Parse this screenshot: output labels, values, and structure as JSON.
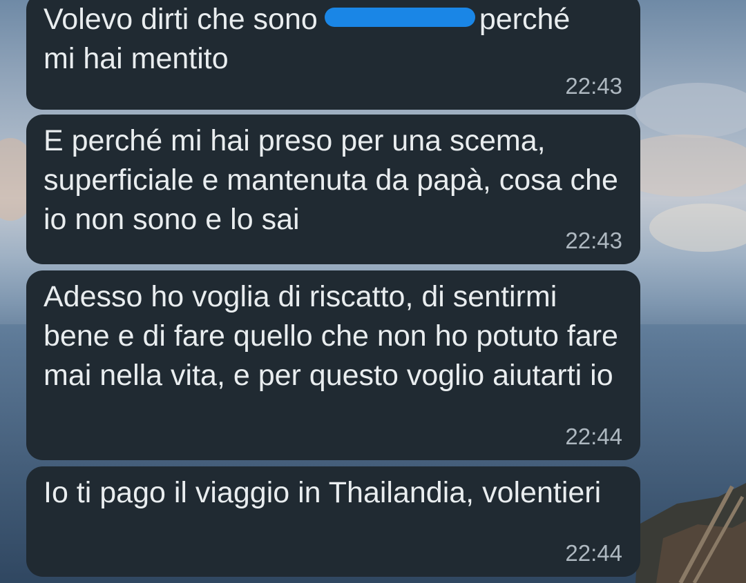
{
  "messages": [
    {
      "text_before": "Volevo dirti che sono",
      "text_after": "perché\nmi hai mentito",
      "redacted": true,
      "time": "22:43"
    },
    {
      "text": "E perché mi hai preso per una scema, superficiale e mantenuta da papà, cosa che io non sono e lo sai",
      "time": "22:43"
    },
    {
      "text": "Adesso ho voglia di riscatto, di sentirmi bene e di fare quello che non ho potuto fare mai nella vita, e per questo voglio aiutarti io",
      "time": "22:44"
    },
    {
      "text": "Io ti pago il viaggio in Thailandia, volentieri",
      "time": "22:44"
    }
  ],
  "colors": {
    "bubble_bg": "#202a32",
    "text": "#e9edef",
    "time": "#aeb8c0",
    "redaction": "#1a86e6"
  },
  "icons": [
    "redaction-scribble"
  ]
}
